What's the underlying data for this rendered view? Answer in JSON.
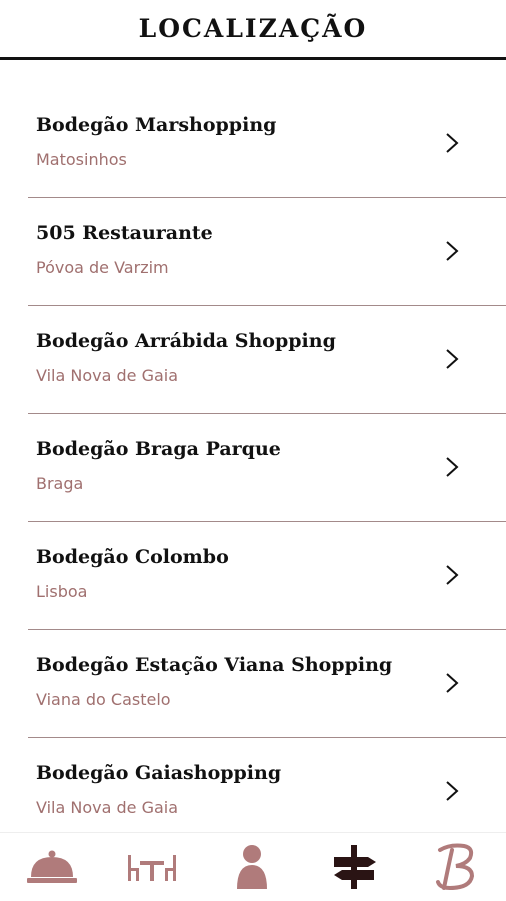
{
  "header": {
    "title": "LOCALIZAÇÃO"
  },
  "locations": [
    {
      "name": "Bodegão Marshopping",
      "city": "Matosinhos"
    },
    {
      "name": "505 Restaurante",
      "city": "Póvoa de Varzim"
    },
    {
      "name": "Bodegão Arrábida Shopping",
      "city": "Vila Nova de Gaia"
    },
    {
      "name": "Bodegão Braga Parque",
      "city": "Braga"
    },
    {
      "name": "Bodegão Colombo",
      "city": "Lisboa"
    },
    {
      "name": "Bodegão Estação Viana Shopping",
      "city": "Viana do Castelo"
    },
    {
      "name": "Bodegão Gaiashopping",
      "city": "Vila Nova de Gaia"
    }
  ],
  "tabbar": {
    "tabs": [
      {
        "icon": "cloche-icon",
        "active": false
      },
      {
        "icon": "table-icon",
        "active": false
      },
      {
        "icon": "person-icon",
        "active": false
      },
      {
        "icon": "signpost-icon",
        "active": true
      },
      {
        "icon": "b-logo-icon",
        "active": false
      }
    ],
    "colors": {
      "active": "#2a1414",
      "inactive": "#b07b7b"
    }
  },
  "colors": {
    "accent": "#a0706f",
    "divider": "#a38a8a",
    "text": "#111111"
  }
}
